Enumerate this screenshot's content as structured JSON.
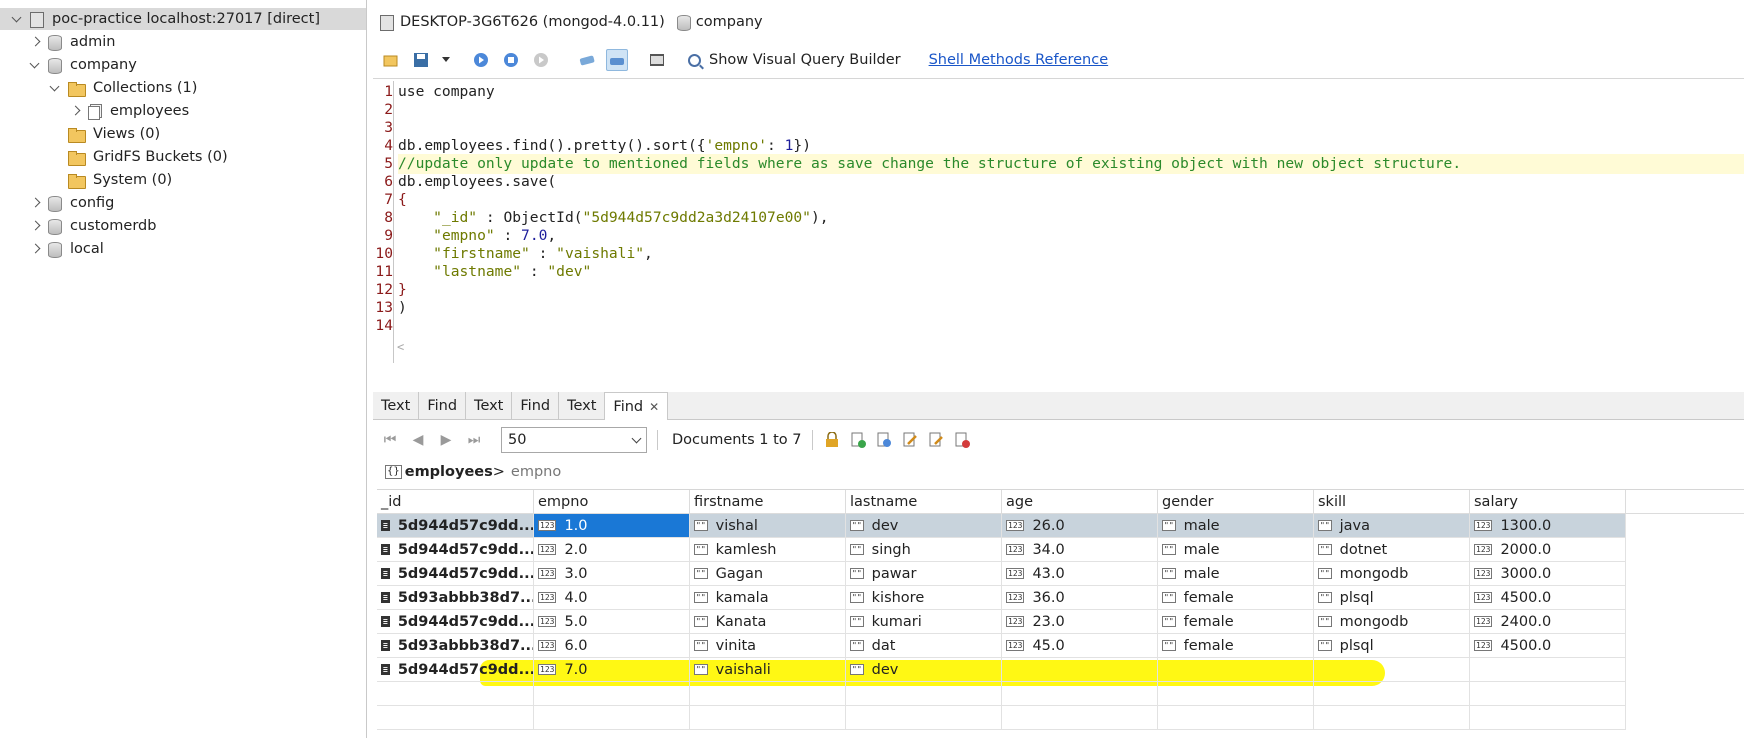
{
  "tree": {
    "server": "poc-practice localhost:27017 [direct]",
    "items": [
      {
        "label": "admin",
        "kind": "db"
      },
      {
        "label": "company",
        "kind": "db"
      },
      {
        "label": "Collections (1)",
        "kind": "folder"
      },
      {
        "label": "employees",
        "kind": "collection"
      },
      {
        "label": "Views (0)",
        "kind": "folder"
      },
      {
        "label": "GridFS Buckets (0)",
        "kind": "folder"
      },
      {
        "label": "System (0)",
        "kind": "folder"
      },
      {
        "label": "config",
        "kind": "db"
      },
      {
        "label": "customerdb",
        "kind": "db"
      },
      {
        "label": "local",
        "kind": "db"
      }
    ]
  },
  "header": {
    "connection": "DESKTOP-3G6T626 (mongod-4.0.11)",
    "database": "company"
  },
  "toolbar": {
    "visual_query_builder": "Show Visual Query Builder",
    "shell_reference": "Shell Methods Reference"
  },
  "editor": {
    "line_numbers": [
      "1",
      "2",
      "3",
      "4",
      "5",
      "6",
      "7",
      "8",
      "9",
      "10",
      "11",
      "12",
      "13",
      "14"
    ]
  },
  "tabs": [
    "Text",
    "Find",
    "Text",
    "Find",
    "Text",
    "Find"
  ],
  "results": {
    "page_size": "50",
    "documents_label": "Documents 1 to 7",
    "breadcrumb_collection": "employees",
    "breadcrumb_separator": ">",
    "breadcrumb_field": "empno",
    "columns": [
      "_id",
      "empno",
      "firstname",
      "lastname",
      "age",
      "gender",
      "skill",
      "salary"
    ],
    "rows": [
      [
        "5d944d57c9dd...",
        "1.0",
        "vishal",
        "dev",
        "26.0",
        "male",
        "java",
        "1300.0"
      ],
      [
        "5d944d57c9dd...",
        "2.0",
        "kamlesh",
        "singh",
        "34.0",
        "male",
        "dotnet",
        "2000.0"
      ],
      [
        "5d944d57c9dd...",
        "3.0",
        "Gagan",
        "pawar",
        "43.0",
        "male",
        "mongodb",
        "3000.0"
      ],
      [
        "5d93abbb38d7...",
        "4.0",
        "kamala",
        "kishore",
        "36.0",
        "female",
        "plsql",
        "4500.0"
      ],
      [
        "5d944d57c9dd...",
        "5.0",
        "Kanata",
        "kumari",
        "23.0",
        "female",
        "mongodb",
        "2400.0"
      ],
      [
        "5d93abbb38d7...",
        "6.0",
        "vinita",
        "dat",
        "45.0",
        "female",
        "plsql",
        "4500.0"
      ],
      [
        "5d944d57c9dd...",
        "7.0",
        "vaishali",
        "dev",
        "",
        "",
        "",
        ""
      ]
    ]
  },
  "colors": {
    "selection": "#1a78d6",
    "highlight": "#fff700",
    "line_numbers": "#8b1a1a"
  }
}
